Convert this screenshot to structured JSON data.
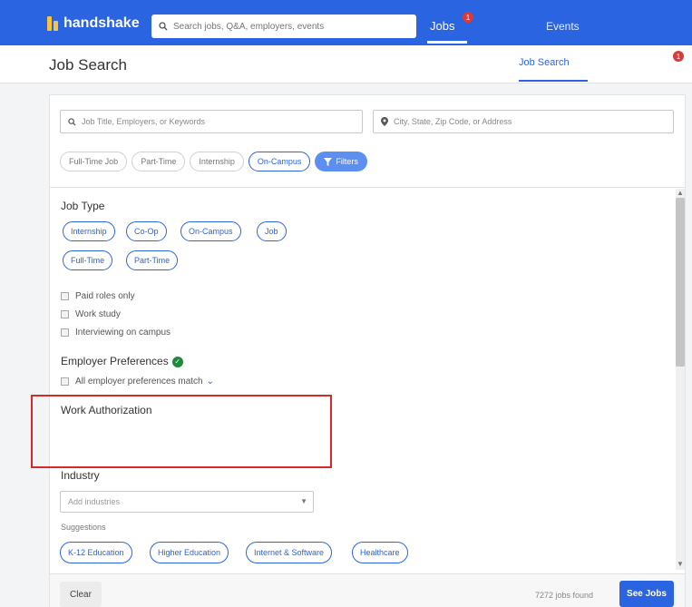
{
  "topbar": {
    "brand": "handshake",
    "search_placeholder": "Search jobs, Q&A, employers, events",
    "nav_jobs": "Jobs",
    "nav_jobs_badge": "1",
    "nav_events": "Events"
  },
  "header": {
    "title": "Job Search",
    "tab_job_search": "Job Search",
    "tab_badge": "1"
  },
  "search": {
    "keywords_placeholder": "Job Title, Employers, or Keywords",
    "location_placeholder": "City, State, Zip Code, or Address"
  },
  "quick_chips": [
    "Full-Time Job",
    "Part-Time",
    "Internship",
    "On-Campus"
  ],
  "filters_label": "Filters",
  "job_type": {
    "title": "Job Type",
    "pills": [
      "Internship",
      "Co-Op",
      "On-Campus",
      "Job",
      "Full-Time",
      "Part-Time"
    ]
  },
  "checkboxes": [
    "Paid roles only",
    "Work study",
    "Interviewing on campus"
  ],
  "employer_prefs": {
    "title": "Employer Preferences",
    "option": "All employer preferences match"
  },
  "work_authorization": {
    "title": "Work Authorization"
  },
  "industry": {
    "title": "Industry",
    "placeholder": "Add industries",
    "suggestions_label": "Suggestions",
    "suggestions": [
      "K-12 Education",
      "Higher Education",
      "Internet & Software",
      "Healthcare"
    ]
  },
  "footer": {
    "clear": "Clear",
    "count": "7272 jobs found",
    "see_jobs": "See Jobs"
  },
  "colors": {
    "brand_blue": "#2a64e0",
    "highlight_red": "#d42a2a",
    "verified_green": "#1d8a3a"
  }
}
